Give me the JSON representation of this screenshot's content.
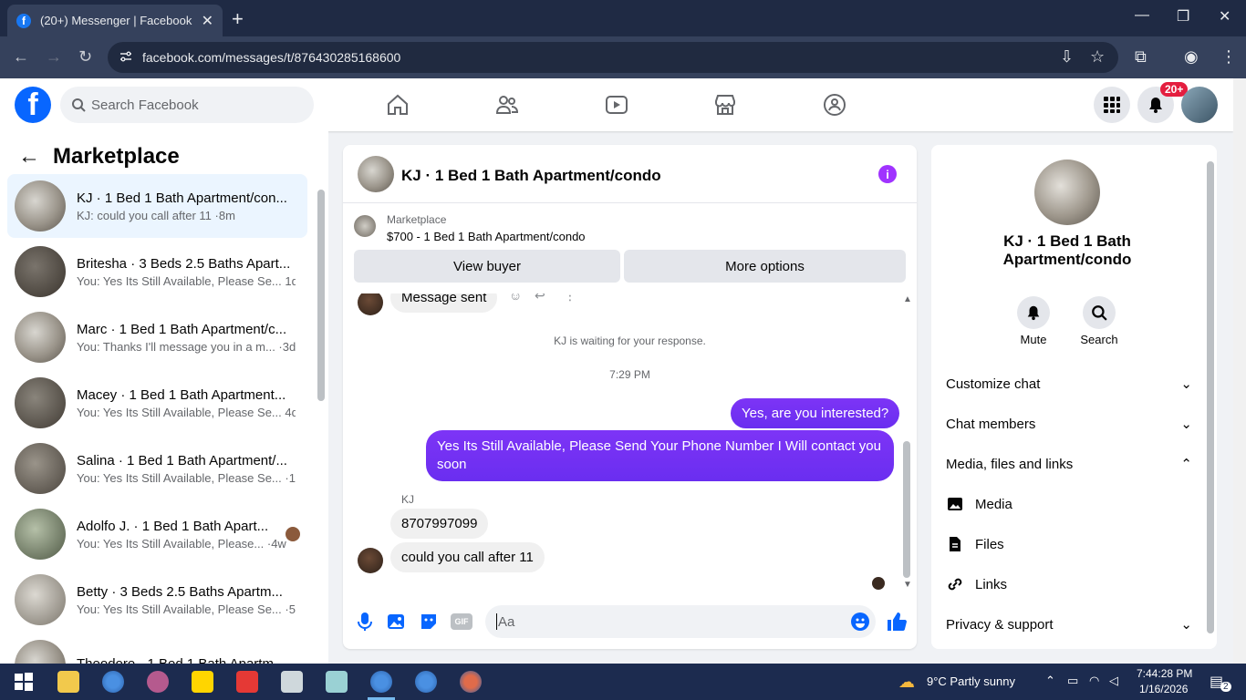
{
  "browser": {
    "tab_title": "(20+) Messenger | Facebook",
    "url": "facebook.com/messages/t/876430285168600"
  },
  "fb_header": {
    "search_placeholder": "Search Facebook",
    "notif_badge": "20+"
  },
  "left_panel": {
    "title": "Marketplace",
    "conversations": [
      {
        "name": "KJ · 1 Bed 1 Bath Apartment/con...",
        "preview": "KJ: could you call after 11 ·8m"
      },
      {
        "name": "Britesha · 3 Beds 2.5 Baths Apart...",
        "preview": "You: Yes Its Still Available, Please Se...  1d"
      },
      {
        "name": "Marc · 1 Bed 1 Bath Apartment/c...",
        "preview": "You: Thanks I'll message you in a m... ·3d"
      },
      {
        "name": "Macey · 1 Bed 1 Bath Apartment...",
        "preview": "You: Yes Its Still Available, Please Se...  4d"
      },
      {
        "name": "Salina · 1 Bed 1 Bath Apartment/...",
        "preview": "You: Yes Its Still Available, Please Se... ·1w"
      },
      {
        "name": "Adolfo J. · 1 Bed 1 Bath Apart...",
        "preview": "You: Yes Its Still Available, Please... ·4w"
      },
      {
        "name": "Betty · 3 Beds 2.5 Baths Apartm...",
        "preview": "You: Yes Its Still Available, Please Se... ·5w"
      },
      {
        "name": "Theodore · 1 Bed 1 Bath Apartm...",
        "preview": ""
      }
    ]
  },
  "chat": {
    "title": "KJ · 1 Bed 1 Bath Apartment/condo",
    "marketplace_label": "Marketplace",
    "listing": "$700 - 1 Bed 1 Bath Apartment/condo",
    "view_buyer": "View buyer",
    "more_options": "More options",
    "message_sent": "Message sent",
    "waiting": "KJ is waiting for your response.",
    "time": "7:29 PM",
    "out1": "Yes, are you interested?",
    "out2": "Yes Its Still Available, Please Send Your Phone Number I Will contact you soon",
    "sender": "KJ",
    "in1": "8707997099",
    "in2": "could you call after 11",
    "input_placeholder": "Aa",
    "gif": "GIF"
  },
  "right_panel": {
    "name_line1": "KJ · 1 Bed 1 Bath",
    "name_line2": "Apartment/condo",
    "mute": "Mute",
    "search": "Search",
    "customize": "Customize chat",
    "members": "Chat members",
    "media_files": "Media, files and links",
    "media": "Media",
    "files": "Files",
    "links": "Links",
    "privacy": "Privacy & support"
  },
  "taskbar": {
    "weather": "9°C  Partly sunny",
    "time": "7:44:28 PM",
    "date": "1/16/2026",
    "notif": "2"
  },
  "colors": {
    "fb_blue": "#0866ff",
    "messenger_purple": "#7b2ff7",
    "taskbar": "#1c2b4f"
  }
}
